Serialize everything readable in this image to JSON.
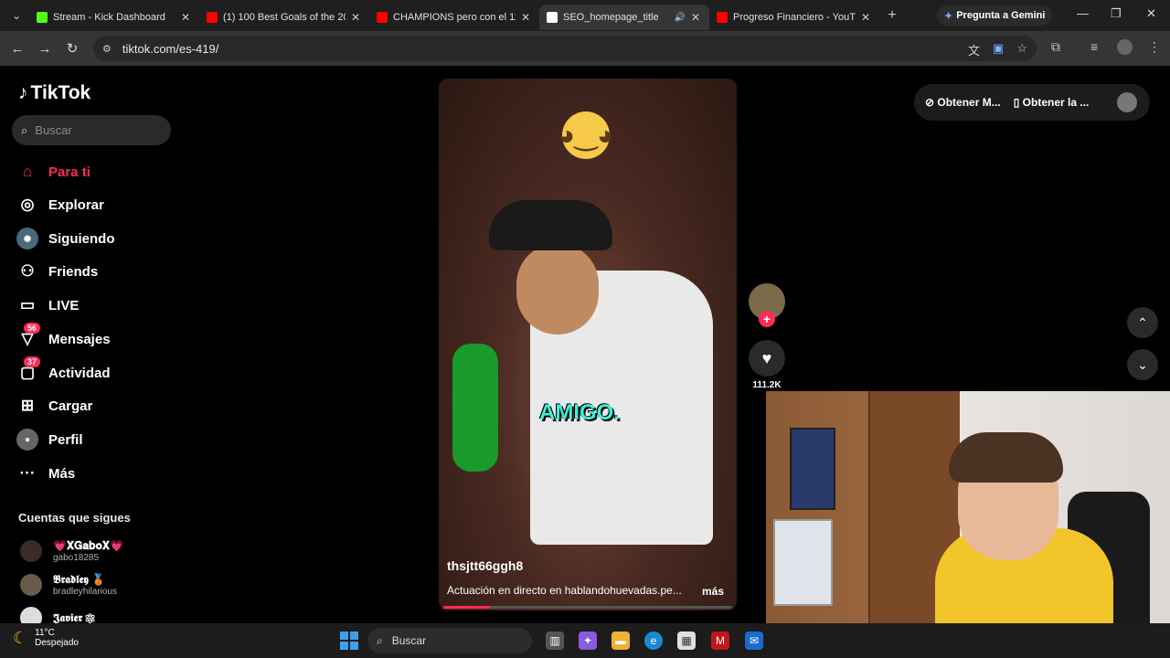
{
  "browser": {
    "tabs": [
      {
        "title": "Stream - Kick Dashboard",
        "favicon_color": "#53fc18"
      },
      {
        "title": "(1) 100 Best Goals of the 20",
        "favicon_color": "#ff0000"
      },
      {
        "title": "CHAMPIONS pero con el 11",
        "favicon_color": "#ff0000"
      },
      {
        "title": "SEO_homepage_title",
        "favicon_color": "#ffffff"
      },
      {
        "title": "Progreso Financiero - YouTu",
        "favicon_color": "#ff0000"
      }
    ],
    "gemini_label": "Pregunta a Gemini",
    "url": "tiktok.com/es-419/"
  },
  "tiktok": {
    "logo": "TikTok",
    "search_placeholder": "Buscar",
    "nav": [
      {
        "label": "Para ti",
        "icon": "home-icon"
      },
      {
        "label": "Explorar",
        "icon": "compass-icon"
      },
      {
        "label": "Siguiendo",
        "icon": "following-icon"
      },
      {
        "label": "Friends",
        "icon": "friends-icon"
      },
      {
        "label": "LIVE",
        "icon": "live-icon"
      },
      {
        "label": "Mensajes",
        "icon": "messages-icon",
        "badge": "56"
      },
      {
        "label": "Actividad",
        "icon": "activity-icon",
        "badge": "37"
      },
      {
        "label": "Cargar",
        "icon": "upload-icon"
      },
      {
        "label": "Perfil",
        "icon": "profile-icon"
      },
      {
        "label": "Más",
        "icon": "more-icon"
      }
    ],
    "follows_title": "Cuentas que sigues",
    "follows": [
      {
        "name": "💗𝐗𝐆𝐚𝐛𝐨𝐗💗",
        "handle": "gabo18285"
      },
      {
        "name": "𝕭𝖗𝖆𝖉𝖑𝖊𝖞 🥉",
        "handle": "bradleyhilarious"
      },
      {
        "name": "𝕵𝖆𝖛𝖎𝖊𝖗 ⚛",
        "handle": ""
      }
    ],
    "video": {
      "caption_word": "AMIGO.",
      "author": "thsjtt66ggh8",
      "description": "Actuación en directo en hablandohuevadas.pe...",
      "more_label": "más",
      "progress": 0.16
    },
    "actions": {
      "likes": "111.2K"
    },
    "top_right": {
      "btn1": "Obtener M...",
      "btn2": "Obtener la ..."
    }
  },
  "taskbar": {
    "temp": "11°C",
    "weather": "Despejado",
    "search": "Buscar"
  },
  "colors": {
    "accent": "#fe2c55"
  }
}
